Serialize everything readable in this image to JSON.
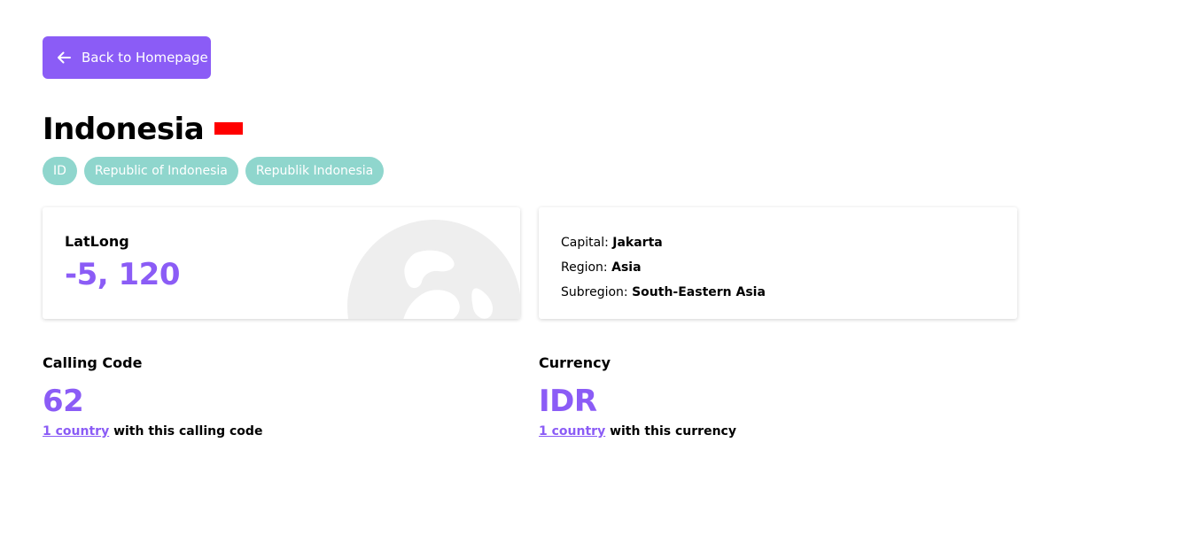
{
  "nav": {
    "back_label": "Back to Homepage"
  },
  "country": {
    "name": "Indonesia",
    "flag_colors": [
      "#ff0000",
      "#ffffff"
    ],
    "tags": [
      "ID",
      "Republic of Indonesia",
      "Republik Indonesia"
    ]
  },
  "latlong": {
    "label": "LatLong",
    "value": "-5, 120"
  },
  "info": {
    "capital_label": "Capital:",
    "capital": "Jakarta",
    "region_label": "Region:",
    "region": "Asia",
    "subregion_label": "Subregion:",
    "subregion": "South-Eastern Asia"
  },
  "calling": {
    "label": "Calling Code",
    "value": "62",
    "link_text": "1 country",
    "note_text": " with this calling code"
  },
  "currency": {
    "label": "Currency",
    "value": "IDR",
    "link_text": "1 country",
    "note_text": " with this currency"
  },
  "colors": {
    "accent": "#8b5cf6",
    "tag_bg": "#8fd6cd"
  }
}
